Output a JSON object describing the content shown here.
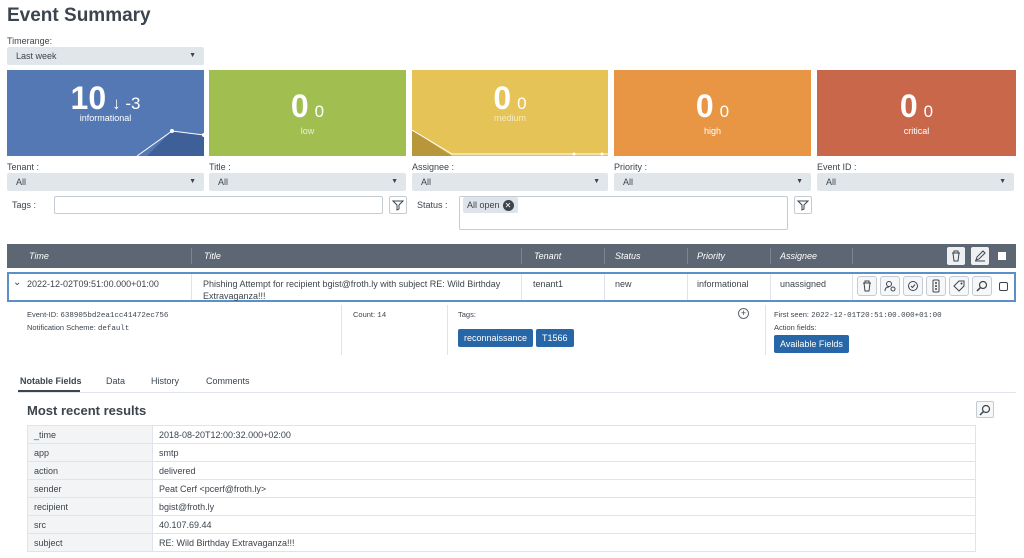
{
  "page": {
    "title": "Event Summary"
  },
  "timerange": {
    "label": "Timerange:",
    "value": "Last week"
  },
  "tiles": [
    {
      "count": "10",
      "delta": "↓ -3",
      "label": "informational",
      "color": "#5378b4"
    },
    {
      "count": "0",
      "delta": "0",
      "label": "low",
      "color": "#a1be51"
    },
    {
      "count": "0",
      "delta": "0",
      "label": "medium",
      "color": "#e5c357"
    },
    {
      "count": "0",
      "delta": "0",
      "label": "high",
      "color": "#e89544"
    },
    {
      "count": "0",
      "delta": "0",
      "label": "critical",
      "color": "#c9674a"
    }
  ],
  "filters": {
    "tenant": {
      "label": "Tenant :",
      "value": "All"
    },
    "title": {
      "label": "Title :",
      "value": "All"
    },
    "assignee": {
      "label": "Assignee :",
      "value": "All"
    },
    "priority": {
      "label": "Priority :",
      "value": "All"
    },
    "event_id": {
      "label": "Event ID :",
      "value": "All"
    },
    "tags": {
      "label": "Tags :",
      "value": ""
    },
    "status": {
      "label": "Status :",
      "chip": "All open",
      "chip_remove": "✕"
    }
  },
  "table": {
    "columns": [
      "Time",
      "Title",
      "Tenant",
      "Status",
      "Priority",
      "Assignee"
    ],
    "row": {
      "expander": "⌄",
      "time": "2022-12-02T09:51:00.000+01:00",
      "title": "Phishing Attempt for recipient bgist@froth.ly with subject RE: Wild Birthday Extravaganza!!!",
      "tenant": "tenant1",
      "status": "new",
      "priority": "informational",
      "assignee": "unassigned"
    }
  },
  "details": {
    "event_id_label": "Event-ID:",
    "event_id": "638905bd2ea1cc41472ec756",
    "notification_label": "Notification Scheme:",
    "notification_scheme": "default",
    "count_label": "Count:",
    "count": "14",
    "tags_label": "Tags:",
    "tags": [
      "reconnaissance",
      "T1566"
    ],
    "add_tag": "+",
    "first_seen_label": "First seen:",
    "first_seen": "2022-12-01T20:51:00.000+01:00",
    "action_fields_label": "Action fields:",
    "available_fields_button": "Available Fields"
  },
  "tabs": [
    "Notable Fields",
    "Data",
    "History",
    "Comments"
  ],
  "results": {
    "title": "Most recent results",
    "rows": [
      {
        "key": "_time",
        "value": "2018-08-20T12:00:32.000+02:00"
      },
      {
        "key": "app",
        "value": "smtp"
      },
      {
        "key": "action",
        "value": "delivered"
      },
      {
        "key": "sender",
        "value": "Peat Cerf <pcerf@froth.ly>"
      },
      {
        "key": "recipient",
        "value": "bgist@froth.ly"
      },
      {
        "key": "src",
        "value": "40.107.69.44"
      },
      {
        "key": "subject",
        "value": "RE: Wild Birthday Extravaganza!!!"
      }
    ]
  },
  "colors": {
    "header_bg": "#5c6773",
    "selected_border": "#5a90c8",
    "tag_bg": "#2767a8"
  }
}
